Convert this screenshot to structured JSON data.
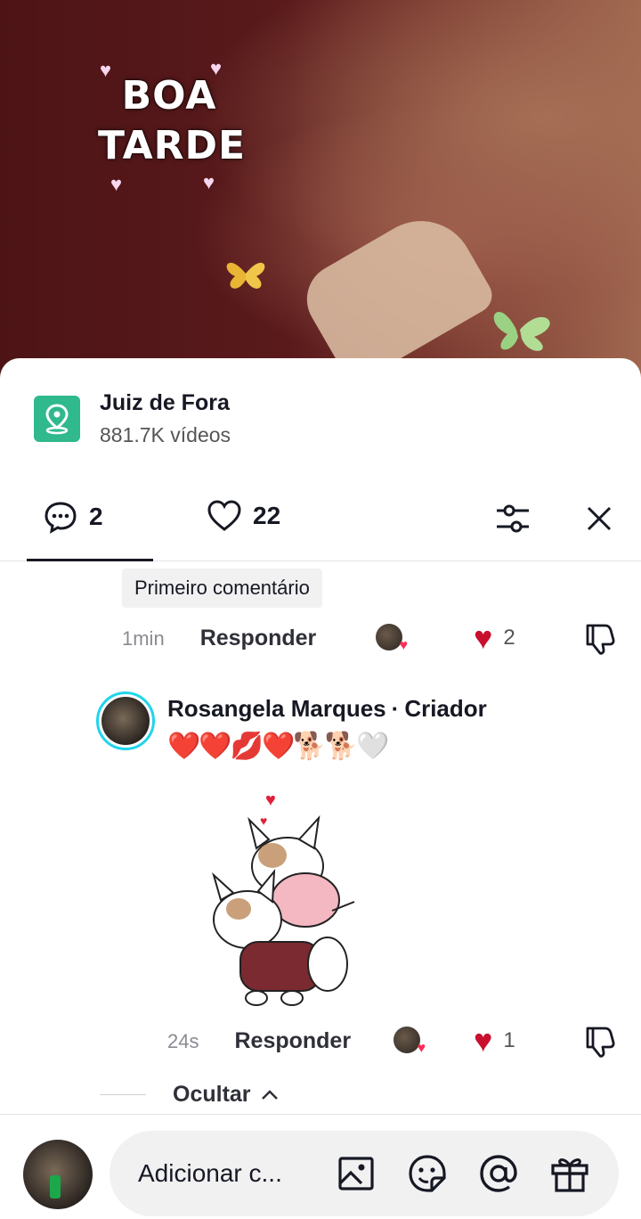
{
  "video": {
    "overlay_line1": "BOA",
    "overlay_line2": "TARDE"
  },
  "location": {
    "name": "Juiz de Fora",
    "count": "881.7K vídeos",
    "icon": "location-pin-icon",
    "color": "#2fb98d"
  },
  "tabs": {
    "comments_count": "2",
    "likes_count": "22"
  },
  "comment1": {
    "badge": "Primeiro comentário",
    "time": "1min",
    "reply": "Responder",
    "likes": "2"
  },
  "comment2": {
    "author": "Rosangela Marques",
    "role": "Criador",
    "text": "❤️❤️💋❤️🐕🐕🤍",
    "time": "24s",
    "reply": "Responder",
    "likes": "1"
  },
  "hide": {
    "label": "Ocultar"
  },
  "input": {
    "placeholder": "Adicionar c..."
  },
  "colors": {
    "accent_like": "#c8102e",
    "creator_ring": "#20d5ec"
  }
}
